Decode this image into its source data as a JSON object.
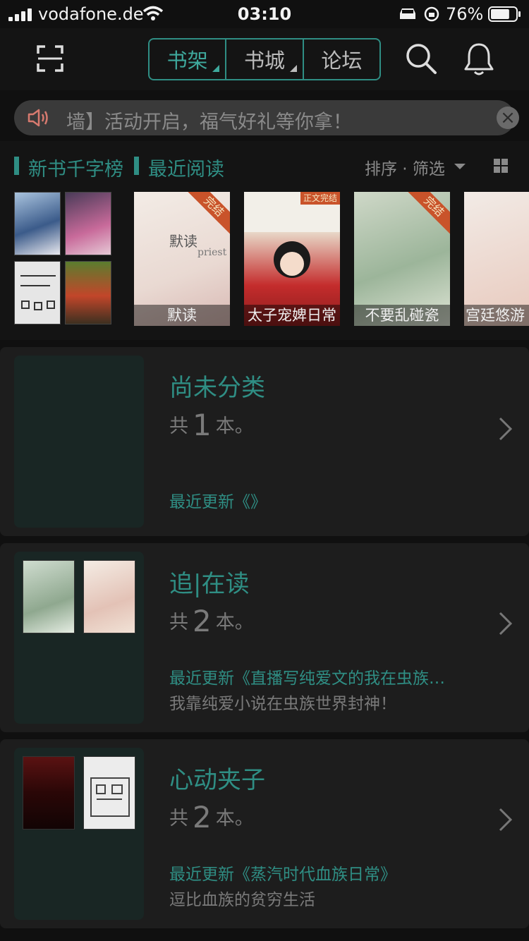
{
  "status_bar": {
    "carrier": "vodafone.de",
    "time": "03:10",
    "battery_percent": "76%",
    "battery_level": 0.76
  },
  "header": {
    "tabs": [
      {
        "label": "书架",
        "active": true,
        "has_dropdown": true
      },
      {
        "label": "书城",
        "active": false,
        "has_dropdown": true
      },
      {
        "label": "论坛",
        "active": false,
        "has_dropdown": false
      }
    ],
    "icons": [
      "scan-icon",
      "search-icon",
      "message-bell-icon"
    ]
  },
  "notice": {
    "text": "墙】活动开启，福气好礼等你拿！",
    "icon": "speaker-icon",
    "close_icon": "close-icon"
  },
  "recent": {
    "tabs": [
      "新书千字榜",
      "最近阅读"
    ],
    "sort_label": "排序 · 筛选",
    "view_icon": "grid-view-icon",
    "books": [
      {
        "title": "默读",
        "author": "priest",
        "badge": "完结"
      },
      {
        "title": "太子宠婢日常",
        "badge": "正文完结"
      },
      {
        "title": "不要乱碰瓷",
        "badge": "完结"
      },
      {
        "title": "宫廷悠游"
      }
    ]
  },
  "groups": [
    {
      "name": "尚未分类",
      "count_prefix": "共",
      "count": "1",
      "count_suffix": "本。",
      "update": "最近更新《》",
      "desc": ""
    },
    {
      "name": "追|在读",
      "count_prefix": "共",
      "count": "2",
      "count_suffix": "本。",
      "update": "最近更新《直播写纯爱文的我在虫族…",
      "desc": "我靠纯爱小说在虫族世界封神！"
    },
    {
      "name": "心动夹子",
      "count_prefix": "共",
      "count": "2",
      "count_suffix": "本。",
      "update": "最近更新《蒸汽时代血族日常》",
      "desc": "逗比血族的贫穷生活"
    }
  ],
  "colors": {
    "accent": "#2f8e84",
    "background": "#101010",
    "card": "#1d1d1d"
  }
}
